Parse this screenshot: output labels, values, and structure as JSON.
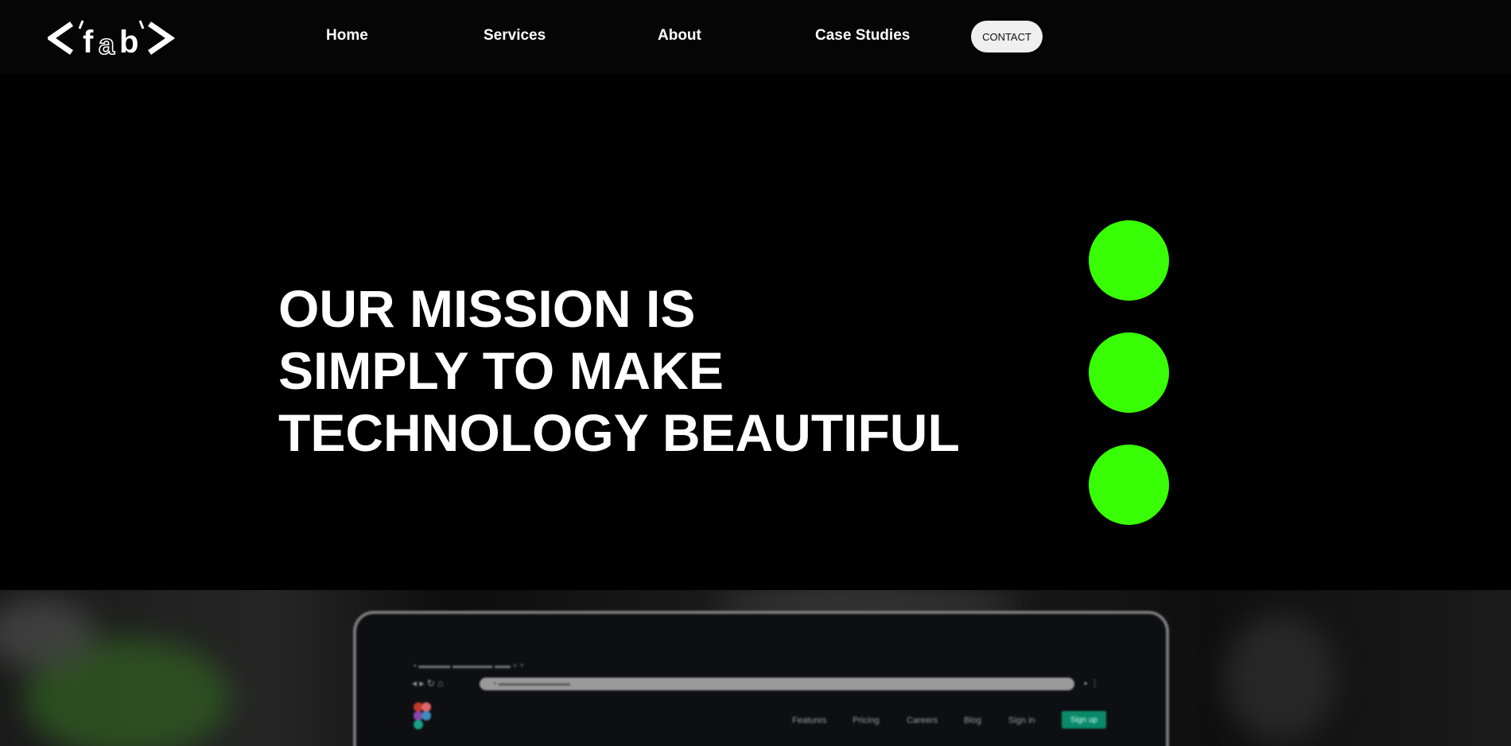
{
  "header": {
    "logo_text": "<'fab'>",
    "nav": {
      "home": "Home",
      "services": "Services",
      "about": "About",
      "case_studies": "Case Studies"
    },
    "contact_label": "CONTACT"
  },
  "hero": {
    "headline_lines": [
      "OUR MISSION IS",
      "SIMPLY TO MAKE",
      "TECHNOLOGY BEAUTIFUL"
    ],
    "accent_color": "#39ff06"
  },
  "photo": {
    "screen_nav": [
      "Features",
      "Pricing",
      "Careers",
      "Blog",
      "Sign in"
    ],
    "signup_label": "Sign up"
  }
}
